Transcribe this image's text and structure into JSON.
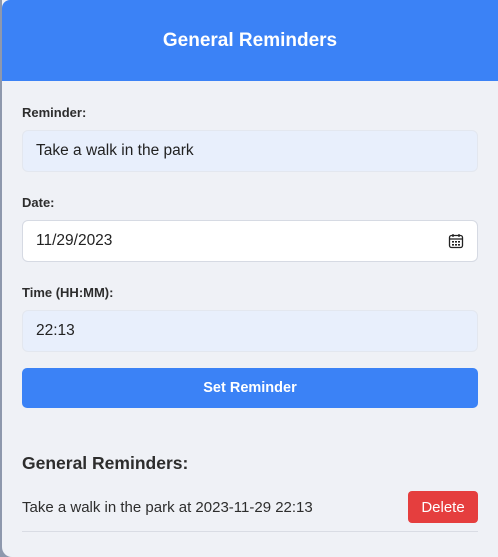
{
  "header": {
    "title": "General Reminders"
  },
  "form": {
    "reminder_label": "Reminder:",
    "reminder_value": "Take a walk in the park",
    "date_label": "Date:",
    "date_value": "11/29/2023",
    "date_icon": "calendar-icon",
    "time_label": "Time (HH:MM):",
    "time_value": "22:13",
    "submit_label": "Set Reminder"
  },
  "list": {
    "title": "General Reminders:",
    "items": [
      {
        "text": "Take a walk in the park at 2023-11-29 22:13",
        "delete_label": "Delete"
      }
    ]
  },
  "colors": {
    "primary": "#3b82f6",
    "danger": "#e53e3e",
    "background": "#eff1f6"
  }
}
